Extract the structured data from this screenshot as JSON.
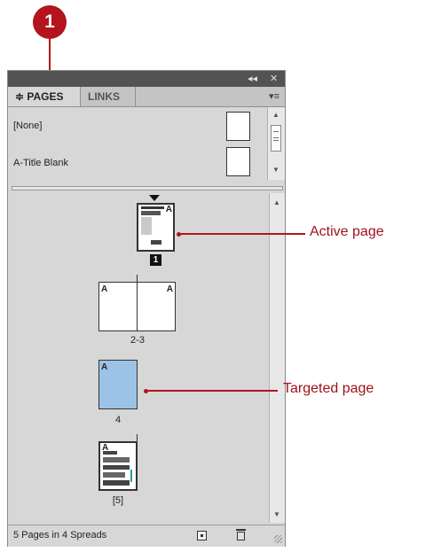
{
  "callout": {
    "number": "1"
  },
  "panel": {
    "titlebar": {
      "collapse_icon": "double-chevron-left-icon",
      "close_icon": "close-icon",
      "collapse_glyph": "◂◂",
      "close_glyph": "✕"
    },
    "tabs": [
      {
        "label": "≑ PAGES",
        "active": true
      },
      {
        "label": "LINKS",
        "active": false
      }
    ],
    "menu_icon": "panel-menu-icon",
    "masters": [
      {
        "label": "[None]"
      },
      {
        "label": "A-Title Blank"
      }
    ],
    "pages": [
      {
        "number": "1",
        "master": "A",
        "active": true
      },
      {
        "number": "2-3",
        "masters": [
          "A",
          "A"
        ]
      },
      {
        "number": "4",
        "master": "A",
        "targeted": true
      },
      {
        "number": "[5]",
        "master": "A"
      }
    ],
    "status": "5 Pages in 4 Spreads",
    "buttons": {
      "new_page": "new-page-icon",
      "delete": "trash-icon"
    }
  },
  "annotations": {
    "active_page": "Active page",
    "targeted_page": "Targeted page"
  },
  "colors": {
    "accent": "#b3141d",
    "targeted_fill": "#9cc3e6"
  }
}
